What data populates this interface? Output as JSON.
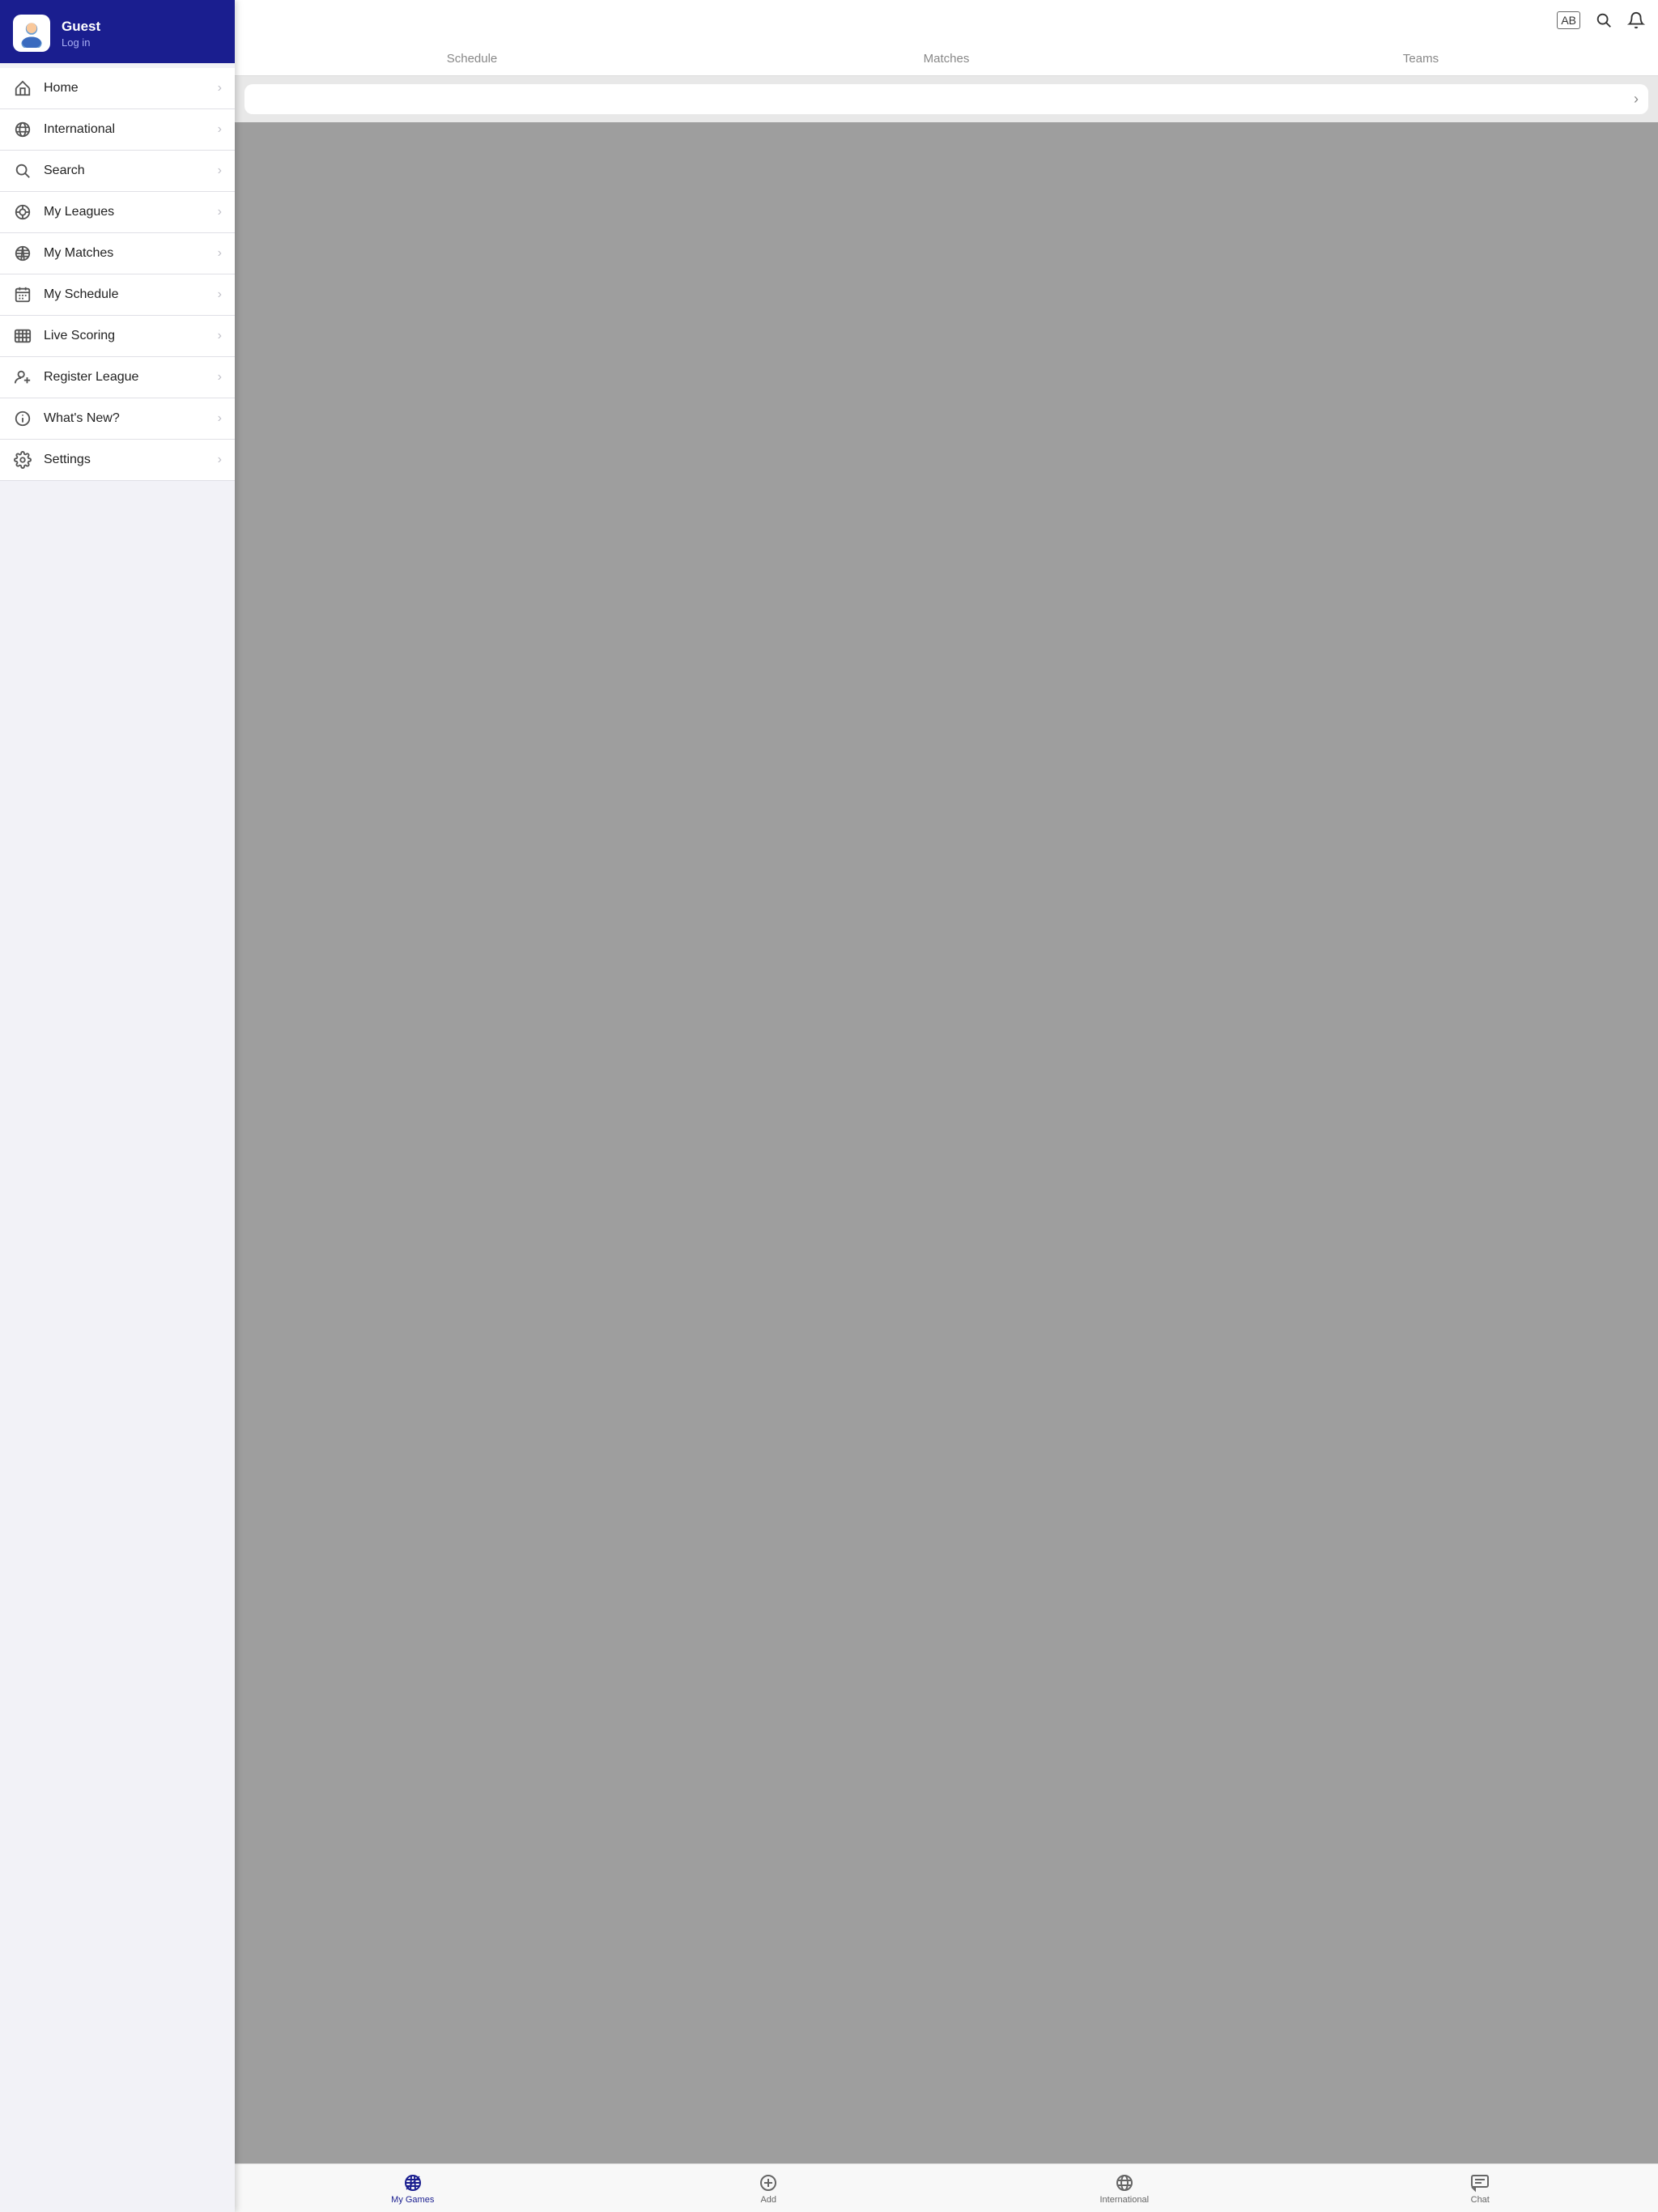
{
  "sidebar": {
    "header": {
      "username": "Guest",
      "login_label": "Log in"
    },
    "nav_items": [
      {
        "id": "home",
        "label": "Home",
        "icon": "home-icon"
      },
      {
        "id": "international",
        "label": "International",
        "icon": "globe-icon"
      },
      {
        "id": "search",
        "label": "Search",
        "icon": "search-icon"
      },
      {
        "id": "my-leagues",
        "label": "My Leagues",
        "icon": "leagues-icon"
      },
      {
        "id": "my-matches",
        "label": "My Matches",
        "icon": "matches-icon"
      },
      {
        "id": "my-schedule",
        "label": "My Schedule",
        "icon": "schedule-icon"
      },
      {
        "id": "live-scoring",
        "label": "Live Scoring",
        "icon": "scoring-icon"
      },
      {
        "id": "register-league",
        "label": "Register League",
        "icon": "register-icon"
      },
      {
        "id": "whats-new",
        "label": "What's New?",
        "icon": "info-icon"
      },
      {
        "id": "settings",
        "label": "Settings",
        "icon": "settings-icon"
      }
    ]
  },
  "header": {
    "ab_icon": "AB",
    "search_icon": "search-header-icon",
    "bell_icon": "notification-icon"
  },
  "tabs": [
    {
      "id": "schedule",
      "label": "Schedule",
      "active": false
    },
    {
      "id": "matches",
      "label": "Matches",
      "active": false
    },
    {
      "id": "teams",
      "label": "Teams",
      "active": false
    }
  ],
  "search_bar": {
    "placeholder": ""
  },
  "bottom_tabs": [
    {
      "id": "my-games",
      "label": "My Games",
      "icon": "my-games-icon",
      "active": true
    },
    {
      "id": "add",
      "label": "Add",
      "icon": "add-icon",
      "active": false
    },
    {
      "id": "international",
      "label": "International",
      "icon": "international-icon",
      "active": false
    },
    {
      "id": "chat",
      "label": "Chat",
      "icon": "chat-icon",
      "active": false
    }
  ],
  "colors": {
    "sidebar_header_bg": "#1a1e8f",
    "active_color": "#1a1e8f",
    "content_bg": "#9e9e9e"
  }
}
